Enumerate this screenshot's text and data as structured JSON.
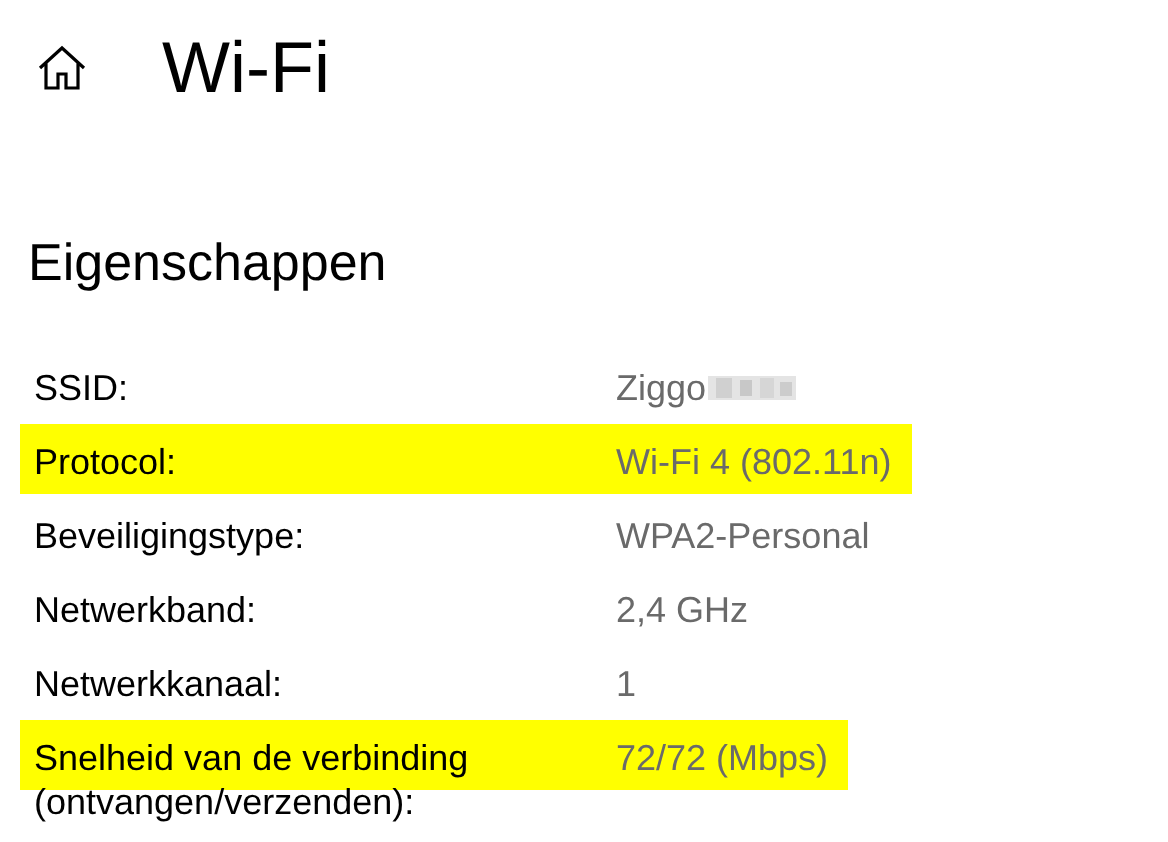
{
  "header": {
    "title": "Wi-Fi"
  },
  "section": {
    "title": "Eigenschappen"
  },
  "properties": [
    {
      "label": "SSID:",
      "value": "Ziggo",
      "redacted": true,
      "highlighted": false
    },
    {
      "label": "Protocol:",
      "value": "Wi-Fi 4 (802.11n)",
      "redacted": false,
      "highlighted": true
    },
    {
      "label": "Beveiligingstype:",
      "value": "WPA2-Personal",
      "redacted": false,
      "highlighted": false
    },
    {
      "label": "Netwerkband:",
      "value": "2,4 GHz",
      "redacted": false,
      "highlighted": false
    },
    {
      "label": "Netwerkkanaal:",
      "value": "1",
      "redacted": false,
      "highlighted": false
    },
    {
      "label": "Snelheid van de verbinding (ontvangen/verzenden):",
      "value": "72/72 (Mbps)",
      "redacted": false,
      "highlighted": true
    }
  ]
}
